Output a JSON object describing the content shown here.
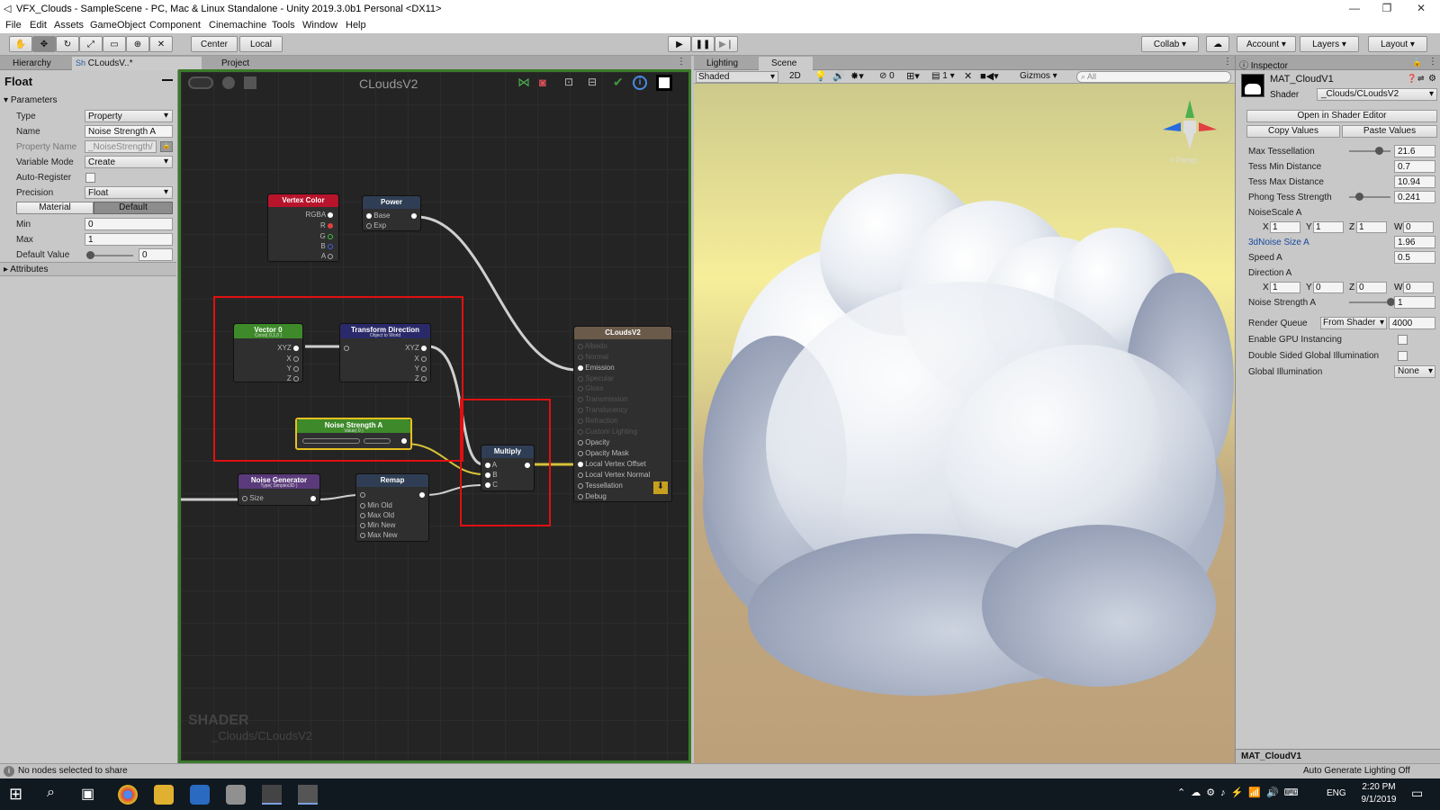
{
  "window": {
    "title": "VFX_Clouds - SampleScene - PC, Mac & Linux Standalone - Unity 2019.3.0b1 Personal <DX11>",
    "minimize": "—",
    "maximize": "❐",
    "close": "✕"
  },
  "menu": [
    "File",
    "Edit",
    "Assets",
    "GameObject",
    "Component",
    "Cinemachine",
    "Tools",
    "Window",
    "Help"
  ],
  "toolbar": {
    "center": "Center",
    "local": "Local",
    "collab": "Collab",
    "account": "Account",
    "layers": "Layers",
    "layout": "Layout"
  },
  "left_tabs": {
    "hierarchy": "Hierarchy",
    "shader_tab": "CLoudsV..*",
    "shader_tab_icon": "Sh",
    "project": "Project"
  },
  "property_panel": {
    "header": "Float",
    "parameters": "Parameters",
    "rows": [
      {
        "label": "Type",
        "value": "Property"
      },
      {
        "label": "Name",
        "value": "Noise Strength A"
      },
      {
        "label": "Property Name",
        "value": "_NoiseStrength/"
      },
      {
        "label": "Variable Mode",
        "value": "Create"
      },
      {
        "label": "Auto-Register",
        "value": ""
      },
      {
        "label": "Precision",
        "value": "Float"
      }
    ],
    "toggle_material": "Material",
    "toggle_default": "Default",
    "min_label": "Min",
    "min_value": "0",
    "max_label": "Max",
    "max_value": "1",
    "default_label": "Default Value",
    "default_value": "0",
    "default_fill": 0,
    "attributes": "Attributes"
  },
  "graph": {
    "title": "CLoudsV2",
    "watermark_big": "SHADER",
    "watermark_small": "_Clouds/CLoudsV2",
    "nodes": {
      "vertex_color": {
        "title": "Vertex Color",
        "ports": [
          "RGBA",
          "R",
          "G",
          "B",
          "A"
        ]
      },
      "power": {
        "title": "Power",
        "ports": [
          "Base",
          "Exp"
        ]
      },
      "vector0": {
        "title": "Vector 0",
        "subtitle": "Const( 0,1,0 )",
        "ports": [
          "XYZ",
          "X",
          "Y",
          "Z"
        ]
      },
      "transform": {
        "title": "Transform Direction",
        "subtitle": "Object to World",
        "ports": [
          "XYZ",
          "X",
          "Y",
          "Z"
        ]
      },
      "noise_strength": {
        "title": "Noise Strength A",
        "subtitle": "Value( 0 )"
      },
      "noise_gen": {
        "title": "Noise Generator",
        "subtitle": "Type( Simplex3D )",
        "ports": [
          "Size"
        ]
      },
      "remap": {
        "title": "Remap",
        "ports": [
          "Min Old",
          "Max Old",
          "Min New",
          "Max New"
        ]
      },
      "multiply": {
        "title": "Multiply",
        "ports": [
          "A",
          "B",
          "C"
        ]
      },
      "master": {
        "title": "CLoudsV2",
        "ports": [
          "Albedo",
          "Normal",
          "Emission",
          "Specular",
          "Gloss",
          "Transmission",
          "Translucency",
          "Refraction",
          "Custom Lighting",
          "Opacity",
          "Opacity Mask",
          "Local Vertex Offset",
          "Local Vertex Normal",
          "Tessellation",
          "Debug"
        ]
      }
    }
  },
  "scene_tabs": {
    "lighting": "Lighting",
    "scene": "Scene"
  },
  "scene_toolbar": {
    "shading": "Shaded",
    "mode2d": "2D",
    "fx_count": "0",
    "layer_count": "1",
    "gizmos": "Gizmos",
    "search_placeholder": "All"
  },
  "scene_gizmo": {
    "persp": "< Persp"
  },
  "inspector": {
    "tab": "Inspector",
    "material": "MAT_CloudV1",
    "shader_label": "Shader",
    "shader_value": "_Clouds/CLoudsV2",
    "open_editor": "Open in Shader Editor",
    "copy_values": "Copy Values",
    "paste_values": "Paste Values",
    "props": [
      {
        "label": "Max Tessellation",
        "value": "21.6",
        "slider": 0.72
      },
      {
        "label": "Tess Min Distance",
        "value": "0.7"
      },
      {
        "label": "Tess Max Distance",
        "value": "10.94"
      },
      {
        "label": "Phong Tess Strength",
        "value": "0.241",
        "slider": 0.24
      }
    ],
    "noise_scale_label": "NoiseScale A",
    "noise_scale": {
      "x": "1",
      "y": "1",
      "z": "1",
      "w": "0"
    },
    "size_label": "3dNoise Size A",
    "size_value": "1.96",
    "speed_label": "Speed A",
    "speed_value": "0.5",
    "direction_label": "Direction A",
    "direction": {
      "x": "1",
      "y": "0",
      "z": "0",
      "w": "0"
    },
    "strength_label": "Noise Strength A",
    "strength_value": "1",
    "strength_slider": 1.0,
    "render_queue_label": "Render Queue",
    "render_queue_mode": "From Shader",
    "render_queue_value": "4000",
    "gpu_instancing": "Enable GPU Instancing",
    "double_sided": "Double Sided Global Illumination",
    "gi_label": "Global Illumination",
    "gi_value": "None",
    "footer": "MAT_CloudV1"
  },
  "status": {
    "left": "No nodes selected to share",
    "right": "Auto Generate Lighting Off"
  },
  "taskbar": {
    "lang": "ENG",
    "time": "2:20 PM",
    "date": "9/1/2019"
  },
  "colors": {
    "graph_border": "#3a7a2a",
    "selection_red": "#e01010",
    "vertex_color": "#b8142c",
    "vector_green": "#3e8a2a",
    "transform_blue": "#2a2a6a",
    "noise_purple": "#5a3a7a"
  }
}
